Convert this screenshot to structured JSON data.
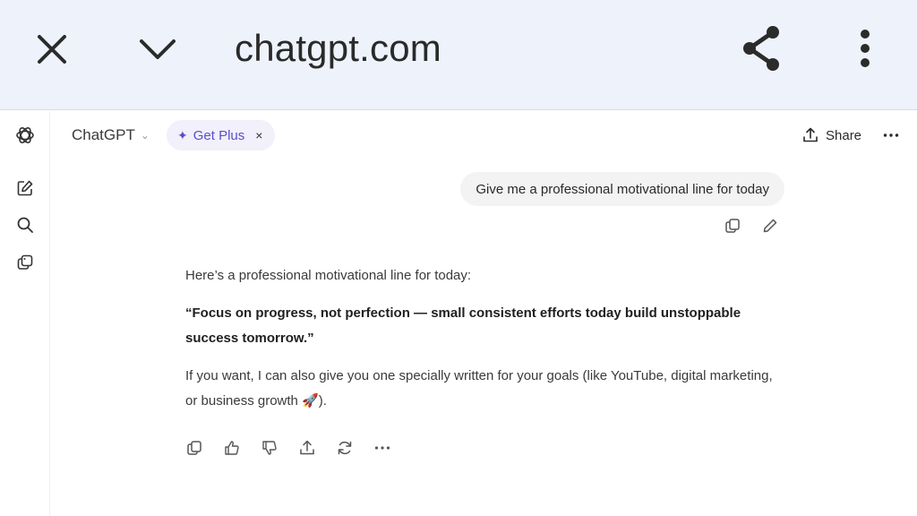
{
  "browser": {
    "url": "chatgpt.com",
    "icons": {
      "close": "close-icon",
      "collapse": "chevron-down-icon",
      "share": "share-icon",
      "menu": "more-vert-icon"
    }
  },
  "header": {
    "model": "ChatGPT",
    "get_plus": "Get Plus",
    "get_plus_close": "×",
    "share": "Share",
    "more": "···"
  },
  "sidebar": {
    "items": [
      {
        "name": "openai-logo-icon"
      },
      {
        "name": "new-chat-icon"
      },
      {
        "name": "search-icon"
      },
      {
        "name": "library-icon"
      }
    ]
  },
  "conversation": {
    "user_message": "Give me a professional motivational line for today",
    "assistant": {
      "intro": "Here’s a professional motivational line for today:",
      "quote": "“Focus on progress, not perfection — small consistent efforts today build unstoppable success tomorrow.”",
      "followup": "If you want, I can also give you one specially written for your goals (like YouTube, digital marketing, or business growth 🚀)."
    }
  },
  "colors": {
    "accent": "#5a4fc9",
    "browser_bar": "#eef3fb",
    "bubble": "#f3f3f3"
  }
}
